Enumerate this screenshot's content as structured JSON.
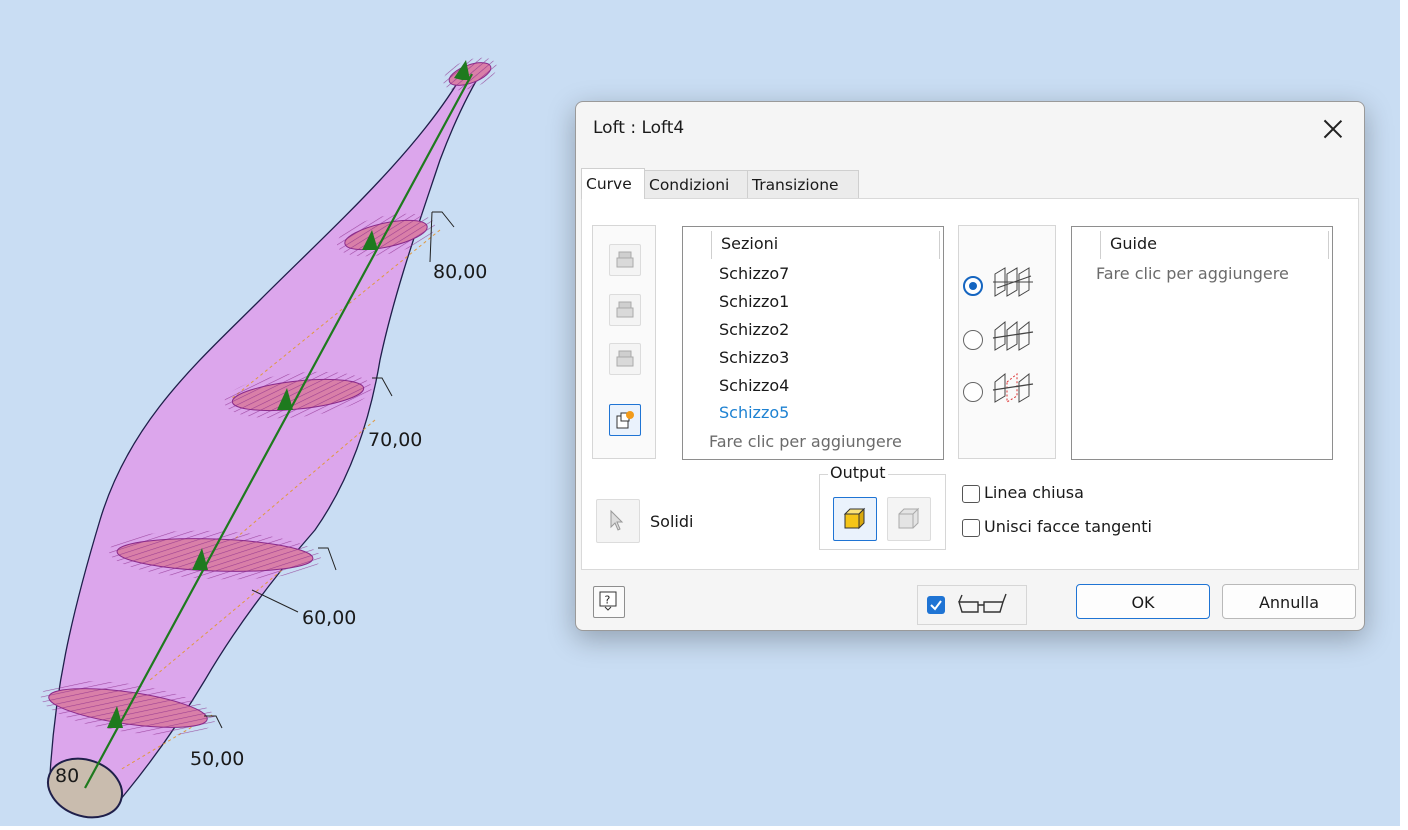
{
  "viewport": {
    "dimensions": [
      "80,00",
      "70,00",
      "60,00",
      "50,00"
    ],
    "sketch_label": "80"
  },
  "dialog": {
    "title": "Loft : Loft4",
    "tabs": [
      {
        "label": "Curve",
        "active": true
      },
      {
        "label": "Condizioni",
        "active": false
      },
      {
        "label": "Transizione",
        "active": false
      }
    ],
    "sections": {
      "header": "Sezioni",
      "items": [
        "Schizzo7",
        "Schizzo1",
        "Schizzo2",
        "Schizzo3",
        "Schizzo4",
        "Schizzo5"
      ],
      "selected_item": "Schizzo5",
      "hint": "Fare clic per aggiungere"
    },
    "guides": {
      "header": "Guide",
      "hint": "Fare clic per aggiungere"
    },
    "solids_label": "Solidi",
    "output": {
      "label": "Output",
      "selected": "solid"
    },
    "loft_type": {
      "options": [
        "rails-icon",
        "center-line-icon",
        "area-loft-icon"
      ],
      "selected_index": 0
    },
    "options": [
      {
        "label": "Linea chiusa",
        "checked": false
      },
      {
        "label": "Unisci facce tangenti",
        "checked": false
      }
    ],
    "preview_checked": true,
    "ok_label": "OK",
    "cancel_label": "Annulla"
  },
  "colors": {
    "viewport_bg": "#c9ddf3",
    "loft_body": "#dca6ec",
    "section_fill": "#d97fa8",
    "rail": "#1e7a1e",
    "accent": "#1565c0",
    "selected_text": "#1e82d2"
  }
}
